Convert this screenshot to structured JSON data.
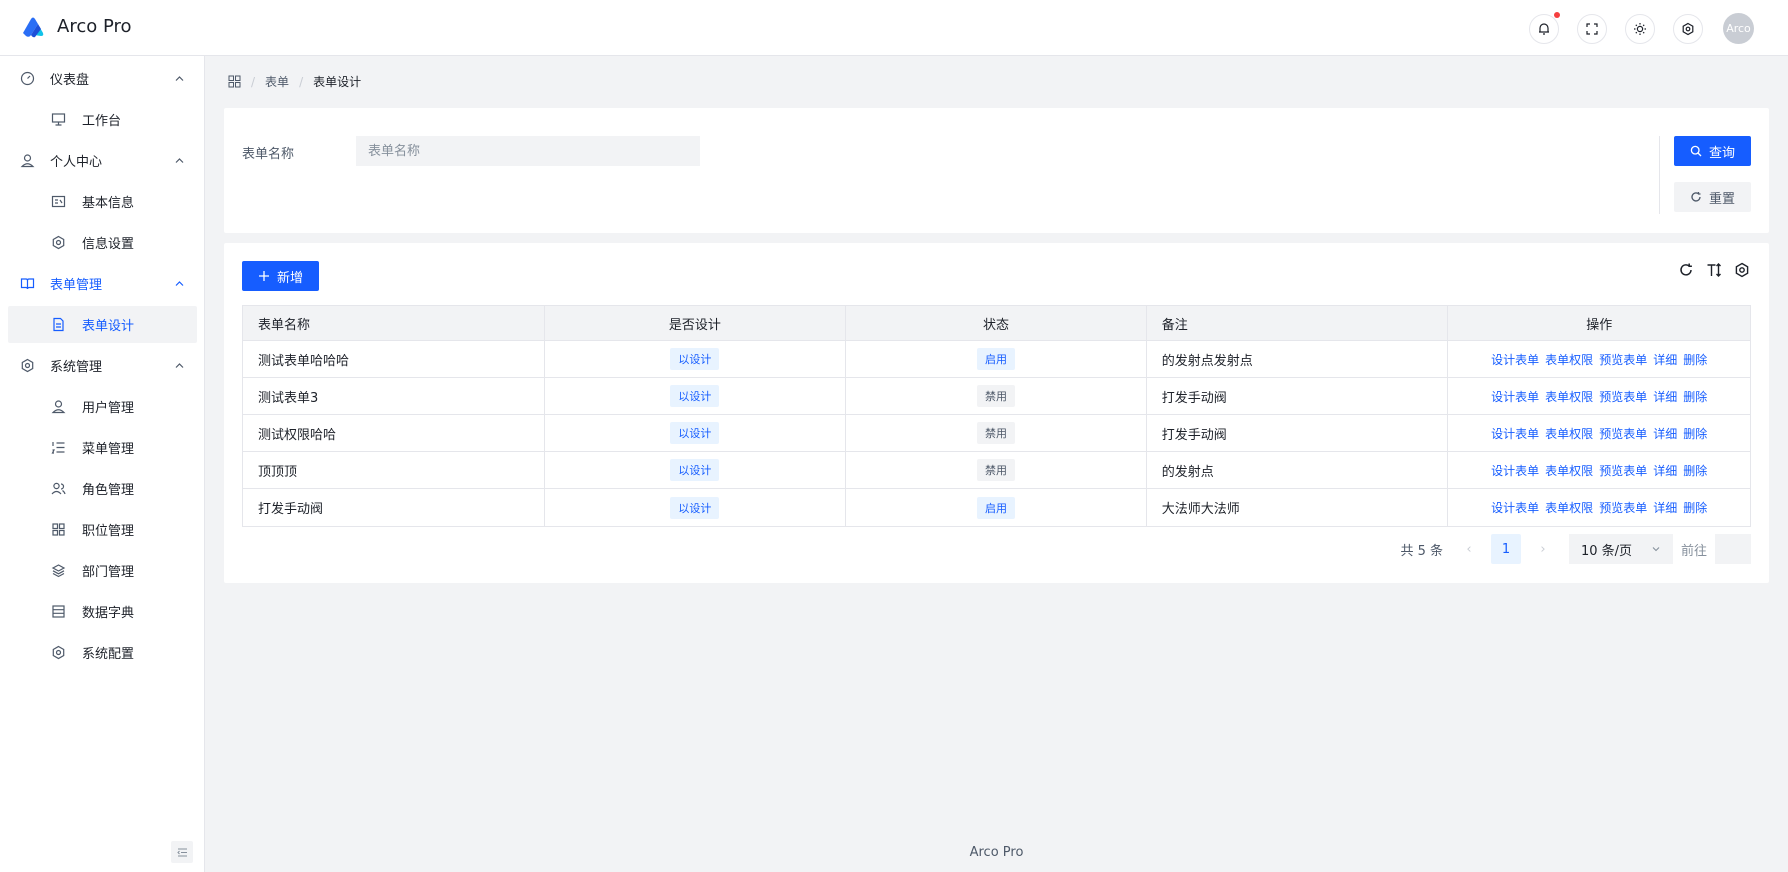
{
  "app": {
    "title": "Arco Pro"
  },
  "header": {
    "avatar_text": "Arco"
  },
  "sidebar": {
    "items": [
      {
        "label": "仪表盘",
        "icon": "dashboard-icon",
        "level": "group"
      },
      {
        "label": "工作台",
        "icon": "monitor-icon",
        "level": "sub"
      },
      {
        "label": "个人中心",
        "icon": "user-icon",
        "level": "group"
      },
      {
        "label": "基本信息",
        "icon": "id-card-icon",
        "level": "sub"
      },
      {
        "label": "信息设置",
        "icon": "settings-icon",
        "level": "sub"
      },
      {
        "label": "表单管理",
        "icon": "book-icon",
        "level": "group"
      },
      {
        "label": "表单设计",
        "icon": "file-icon",
        "level": "sub"
      },
      {
        "label": "系统管理",
        "icon": "settings-icon",
        "level": "group"
      },
      {
        "label": "用户管理",
        "icon": "user-icon",
        "level": "sub"
      },
      {
        "label": "菜单管理",
        "icon": "ordered-list-icon",
        "level": "sub"
      },
      {
        "label": "角色管理",
        "icon": "user-group-icon",
        "level": "sub"
      },
      {
        "label": "职位管理",
        "icon": "apps-icon",
        "level": "sub"
      },
      {
        "label": "部门管理",
        "icon": "layers-icon",
        "level": "sub"
      },
      {
        "label": "数据字典",
        "icon": "storage-icon",
        "level": "sub"
      },
      {
        "label": "系统配置",
        "icon": "settings-icon",
        "level": "sub"
      }
    ],
    "active_item": "表单设计"
  },
  "breadcrumb": {
    "home_icon": "apps-icon",
    "items": [
      "表单",
      "表单设计"
    ]
  },
  "search": {
    "label": "表单名称",
    "placeholder": "表单名称",
    "query_label": "查询",
    "reset_label": "重置"
  },
  "toolbar": {
    "add_label": "新增"
  },
  "table": {
    "columns": [
      "表单名称",
      "是否设计",
      "状态",
      "备注",
      "操作"
    ],
    "rows": [
      {
        "name": "测试表单哈哈哈",
        "designed": "以设计",
        "status": "启用",
        "note": "的发射点发射点"
      },
      {
        "name": "测试表单3",
        "designed": "以设计",
        "status": "禁用",
        "note": "打发手动阀"
      },
      {
        "name": "测试权限哈哈",
        "designed": "以设计",
        "status": "禁用",
        "note": "打发手动阀"
      },
      {
        "name": "顶顶顶",
        "designed": "以设计",
        "status": "禁用",
        "note": "的发射点"
      },
      {
        "name": "打发手动阀",
        "designed": "以设计",
        "status": "启用",
        "note": "大法师大法师"
      }
    ],
    "actions": [
      "设计表单",
      "表单权限",
      "预览表单",
      "详细",
      "删除"
    ]
  },
  "pagination": {
    "total_text": "共 5 条",
    "current_page": "1",
    "page_size": "10 条/页",
    "jump_label": "前往"
  },
  "footer": {
    "text": "Arco Pro"
  },
  "colors": {
    "primary": "#165dff",
    "danger_dot": "#f53f3f",
    "bg": "#f2f3f5"
  }
}
